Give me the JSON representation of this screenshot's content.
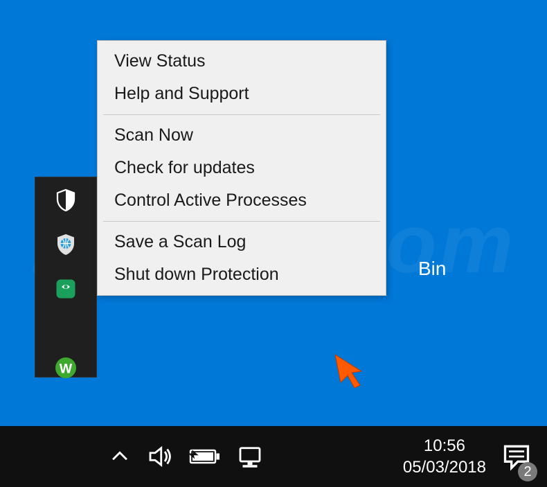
{
  "context_menu": {
    "items": [
      {
        "label": "View Status"
      },
      {
        "label": "Help and Support"
      },
      {
        "label": "Scan Now"
      },
      {
        "label": "Check for updates"
      },
      {
        "label": "Control Active Processes"
      },
      {
        "label": "Save a Scan Log"
      },
      {
        "label": "Shut down Protection"
      }
    ]
  },
  "desktop": {
    "recycle_label": "Bin"
  },
  "taskbar": {
    "time": "10:56",
    "date": "05/03/2018",
    "notification_count": "2"
  },
  "watermark": {
    "text": "PCrisk.com"
  }
}
